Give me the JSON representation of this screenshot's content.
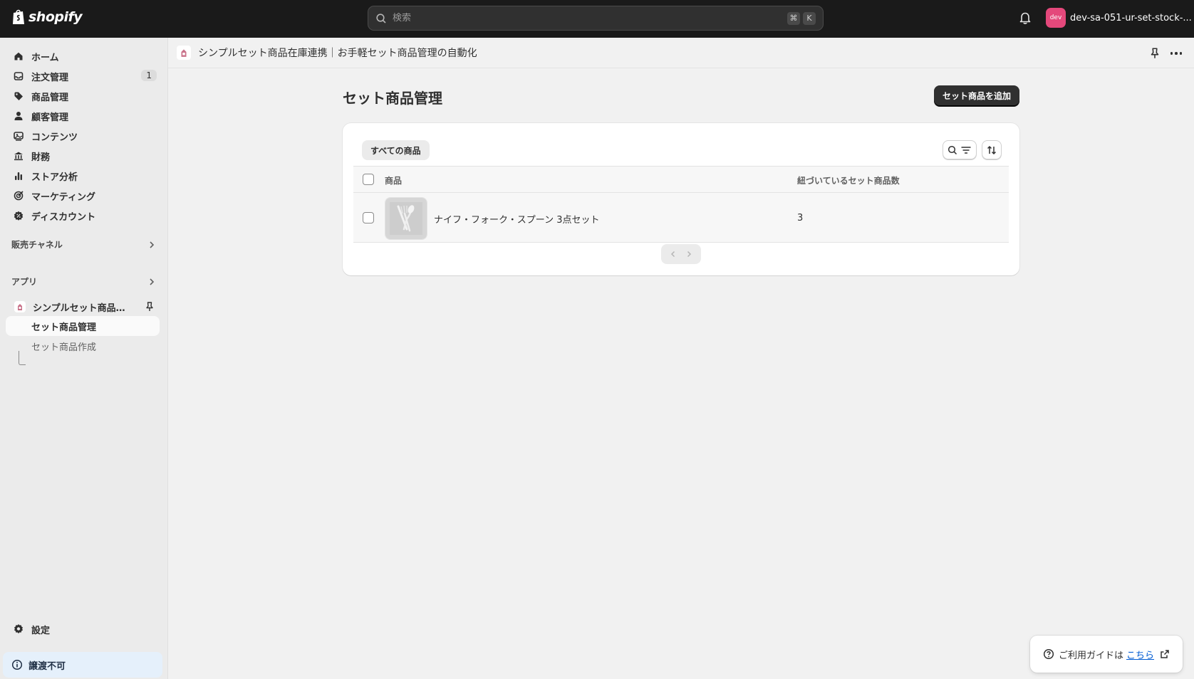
{
  "topbar": {
    "brand": "shopify",
    "search_placeholder": "検索",
    "shortcut_keys": [
      "⌘",
      "K"
    ],
    "store_avatar": "dev",
    "store_name": "dev-sa-051-ur-set-stock-..."
  },
  "sidebar": {
    "items": [
      {
        "label": "ホーム",
        "icon": "home-icon"
      },
      {
        "label": "注文管理",
        "icon": "inbox-icon",
        "badge": "1"
      },
      {
        "label": "商品管理",
        "icon": "tag-icon"
      },
      {
        "label": "顧客管理",
        "icon": "person-icon"
      },
      {
        "label": "コンテンツ",
        "icon": "image-icon"
      },
      {
        "label": "財務",
        "icon": "bank-icon"
      },
      {
        "label": "ストア分析",
        "icon": "bar-chart-icon"
      },
      {
        "label": "マーケティング",
        "icon": "target-icon"
      },
      {
        "label": "ディスカウント",
        "icon": "discount-icon"
      }
    ],
    "sales_channels_label": "販売チャネル",
    "apps_label": "アプリ",
    "app_name": "シンプルセット商品在庫連携｜お手軽セット商品管理の自動化",
    "sub_items": [
      {
        "label": "セット商品管理",
        "active": true
      },
      {
        "label": "セット商品作成",
        "active": false
      }
    ],
    "settings_label": "設定",
    "transfer_label": "譲渡不可"
  },
  "appbar": {
    "title": "シンプルセット商品在庫連携｜お手軽セット商品管理の自動化"
  },
  "page": {
    "title": "セット商品管理",
    "add_button": "セット商品を追加",
    "tab_all": "すべての商品",
    "columns": [
      "商品",
      "紐づいているセット商品数"
    ],
    "rows": [
      {
        "product": "ナイフ・フォーク・スプーン 3点セット",
        "count": "3"
      }
    ]
  },
  "guide": {
    "text": "ご利用ガイドは",
    "link": "こちら"
  },
  "colors": {
    "topbar": "#1a1a1a",
    "accent_link": "#005bd3",
    "store_avatar": "#e4487b",
    "primary_button": "#303030"
  }
}
